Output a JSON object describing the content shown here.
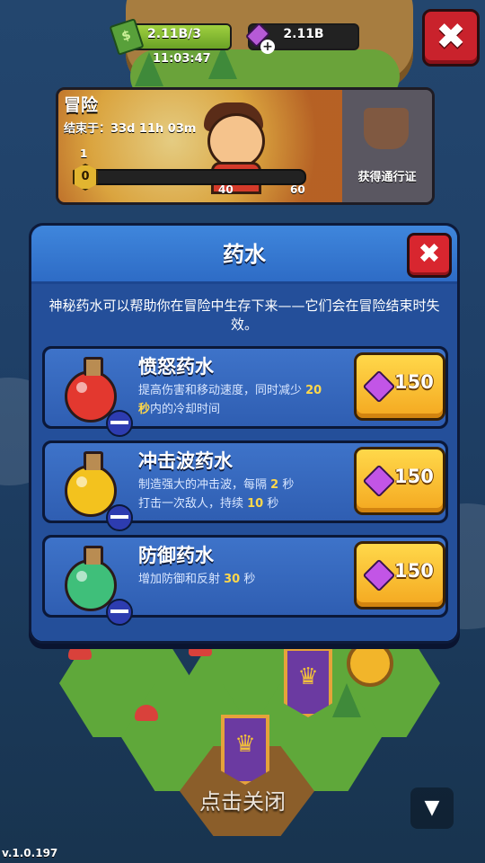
{
  "hud": {
    "cash_value": "2.11B/3",
    "gems_value": "2.11B",
    "timer": "11:03:47"
  },
  "event": {
    "title": "冒险",
    "ends_in": "结束于：33d 11h 03m",
    "level_badge": "0",
    "level_num": "1",
    "marks": [
      "40",
      "60"
    ],
    "pass_label": "获得通行证"
  },
  "dialog": {
    "title": "药水",
    "description": "神秘药水可以帮助你在冒险中生存下来——它们会在冒险结束时失效。",
    "potions": [
      {
        "name": "愤怒药水",
        "desc_a": "提高伤害和移动速度，同时减少 ",
        "desc_hl1": "20",
        "desc_b": "秒",
        "desc_c": "内的冷却时间",
        "price": "150",
        "color": "#e3382f"
      },
      {
        "name": "冲击波药水",
        "desc_a": "制造强大的冲击波，每隔 ",
        "desc_hl1": "2",
        "desc_b": " 秒",
        "desc_c": "打击一次敌人，持续 ",
        "desc_hl2": "10",
        "desc_d": " 秒",
        "price": "150",
        "color": "#f3c21e"
      },
      {
        "name": "防御药水",
        "desc_a": "增加防御和反射 ",
        "desc_hl1": "30",
        "desc_b": " 秒",
        "price": "150",
        "color": "#3fbf7a"
      }
    ]
  },
  "footer": {
    "tap_to_close": "点击关闭",
    "version": "v.1.0.197"
  },
  "colors": {
    "dialog_bg": "#2a62b4",
    "buy_button": "#f4a820",
    "close_red": "#d8262f",
    "gem_purple": "#c255e6"
  }
}
